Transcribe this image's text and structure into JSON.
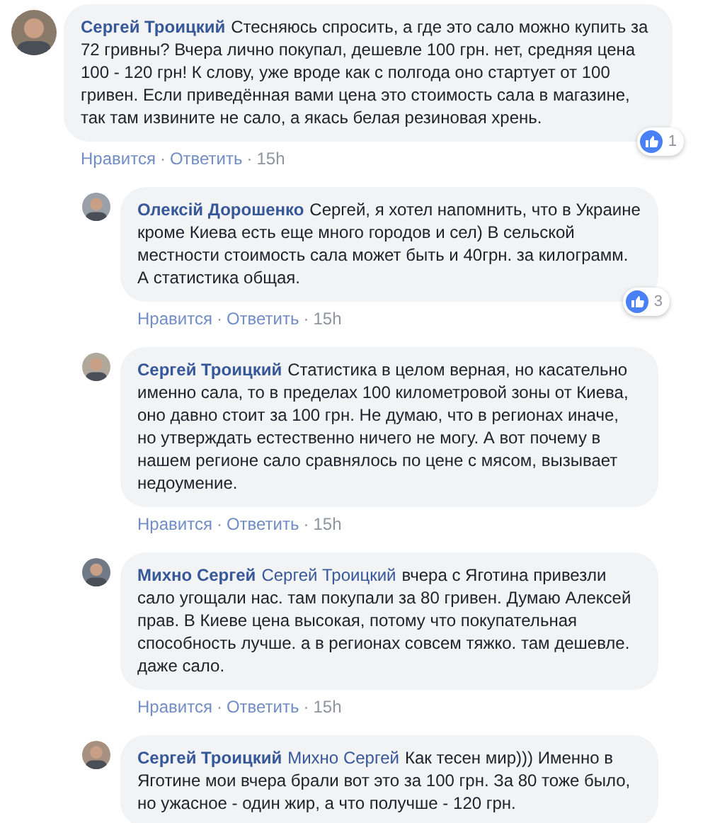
{
  "separator": "·",
  "comment": {
    "name": "Сергей Троицкий",
    "text": "Стесняюсь спросить, а где это сало можно купить за 72 гривны? Вчера лично покупал, дешевле 100 грн. нет, средняя цена 100 - 120 грн! К слову, уже вроде как с полгода оно стартует от 100 гривен. Если приведённая вами цена это стоимость сала в магазине, так там извините не сало, а якась белая резиновая хрень.",
    "actions": [
      "Нравится",
      "Ответить",
      "15h"
    ],
    "reactions": "1",
    "children": [
      {
        "name": "Олексій Дорошенко",
        "text": "Сергей, я хотел напомнить, что в Украине кроме Киева есть еще много городов и сел) В сельской местности стоимость сала может быть и 40грн. за килограмм. А статистика общая.",
        "actions": [
          "Нравится",
          "Ответить",
          "15h"
        ],
        "reactions": "3"
      },
      {
        "name": "Сергей Троицкий",
        "text": "Статистика в целом верная, но касательно именно сала, то в пределах 100 километровой зоны от Киева, оно давно стоит за 100 грн. Не думаю, что в регионах иначе, но утверждать естественно ничего не могу. А вот почему в нашем регионе сало сравнялось по цене с мясом, вызывает недоумение.",
        "actions": [
          "Нравится",
          "Ответить",
          "15h"
        ]
      },
      {
        "name": "Михно Сергей",
        "mention": "Сергей Троицкий",
        "text": "вчера с Яготина привезли сало угощали нас. там покупали за 80 гривен. Думаю Алексей прав. В Киеве цена высокая, потому что покупательная способность лучше. а в регионах совсем тяжко. там дешевле. даже сало.",
        "actions": [
          "Нравится",
          "Ответить",
          "15h"
        ]
      },
      {
        "name": "Сергей Троицкий",
        "mention": "Михно Сергей",
        "text": "Как тесен мир))) Именно в Яготине мои вчера брали вот это за 100 грн. За 80 тоже было, но ужасное - один жир, а что получше - 120 грн."
      }
    ]
  }
}
